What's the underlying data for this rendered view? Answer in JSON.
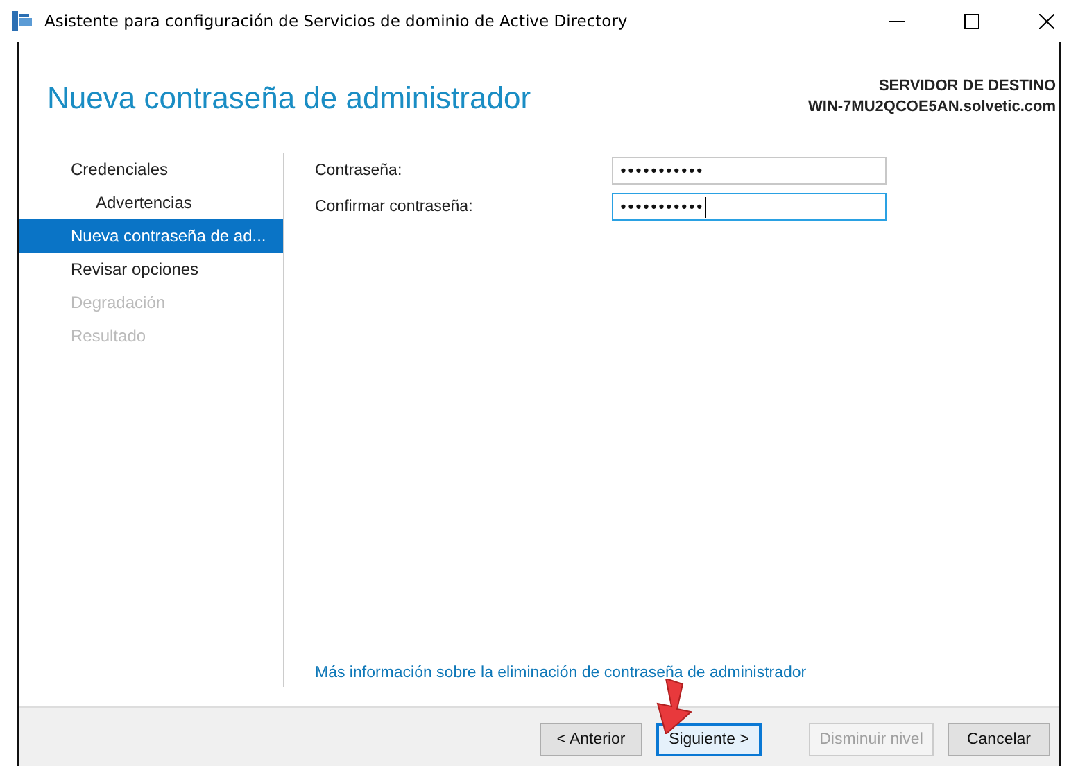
{
  "window": {
    "title": "Asistente para configuración de Servicios de dominio de Active Directory"
  },
  "header": {
    "title": "Nueva contraseña de administrador",
    "server_label": "SERVIDOR DE DESTINO",
    "server_name": "WIN-7MU2QCOE5AN.solvetic.com"
  },
  "sidebar": {
    "items": [
      {
        "label": "Credenciales",
        "selected": false,
        "disabled": false,
        "children": [
          {
            "label": "Advertencias",
            "selected": false,
            "disabled": false
          }
        ]
      },
      {
        "label": "Nueva contraseña de ad...",
        "selected": true,
        "disabled": false
      },
      {
        "label": "Revisar opciones",
        "selected": false,
        "disabled": false
      },
      {
        "label": "Degradación",
        "selected": false,
        "disabled": true
      },
      {
        "label": "Resultado",
        "selected": false,
        "disabled": true
      }
    ]
  },
  "fields": [
    {
      "label": "Contraseña:",
      "value": "•••••••••••",
      "focused": false
    },
    {
      "label": "Confirmar contraseña:",
      "value": "•••••••••••",
      "focused": true
    }
  ],
  "help_link": "Más información sobre la eliminación de contraseña de administrador",
  "buttons": [
    {
      "label": "< Anterior",
      "default": false,
      "disabled": false
    },
    {
      "label": "Siguiente >",
      "default": true,
      "disabled": false
    },
    {
      "label": "Disminuir nivel",
      "default": false,
      "disabled": true
    },
    {
      "label": "Cancelar",
      "default": false,
      "disabled": false
    }
  ]
}
